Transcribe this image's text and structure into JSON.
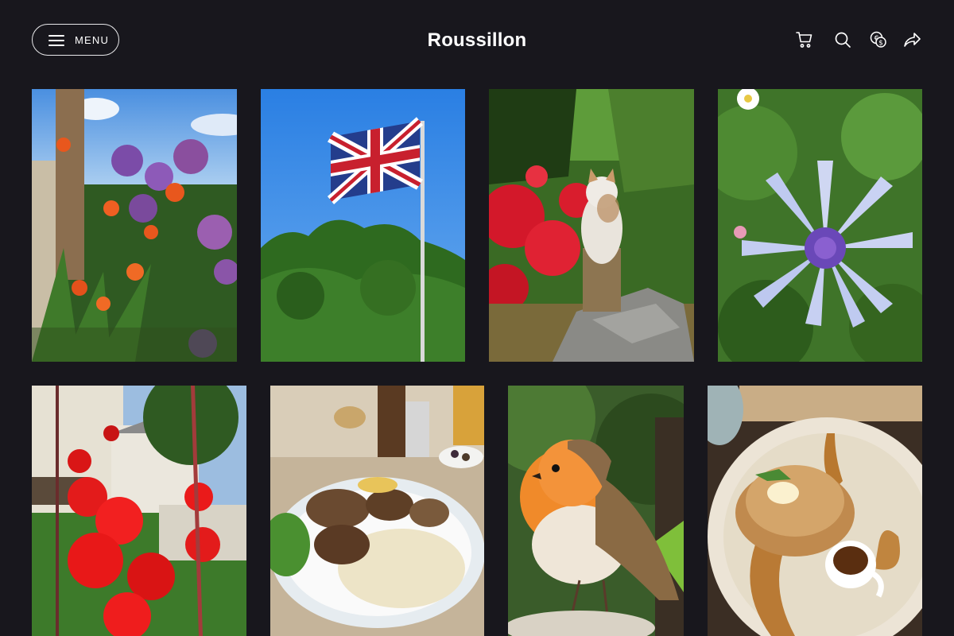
{
  "header": {
    "menu_label": "MENU",
    "site_title": "Roussillon",
    "icons": {
      "cart": "cart-icon",
      "search": "search-icon",
      "currency": "currency-icon",
      "share": "share-icon"
    }
  },
  "gallery": {
    "items": [
      {
        "subject": "flowers-garden"
      },
      {
        "subject": "union-jack-flag"
      },
      {
        "subject": "cat-on-stones"
      },
      {
        "subject": "cornflower"
      },
      {
        "subject": "red-gladiolus"
      },
      {
        "subject": "meal-plate"
      },
      {
        "subject": "robin-bird"
      },
      {
        "subject": "pancake-dessert"
      }
    ]
  },
  "colors": {
    "background": "#18171d",
    "text": "#ffffff",
    "outline": "#e8e8ea"
  }
}
